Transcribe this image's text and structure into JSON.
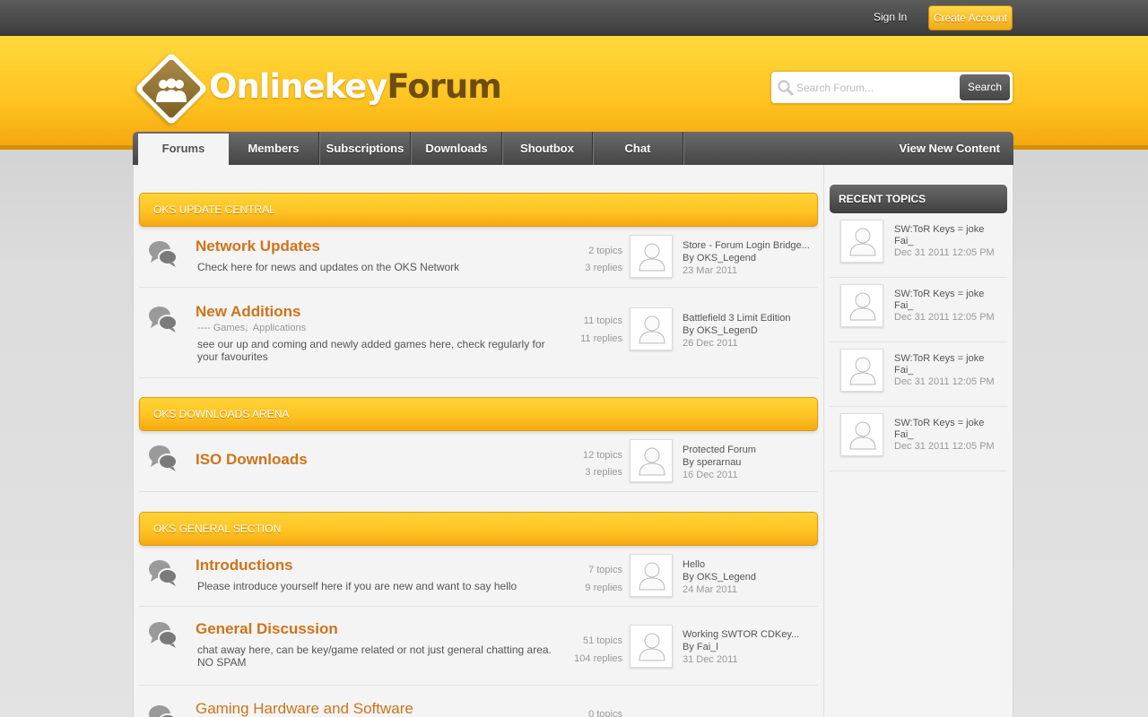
{
  "topbar": {
    "signin": "Sign In",
    "create_account": "Create Account"
  },
  "logo": {
    "part1": "Onlinekey",
    "part2": "Forum"
  },
  "search": {
    "placeholder": "Search Forum...",
    "button": "Search"
  },
  "nav": {
    "tabs": [
      "Forums",
      "Members",
      "Subscriptions",
      "Downloads",
      "Shoutbox",
      "Chat"
    ],
    "active": "Forums",
    "right": "View New Content"
  },
  "categories": [
    {
      "title": "OKS UPDATE CENTRAL"
    },
    {
      "title": "OKS DOWNLOADS ARENA"
    },
    {
      "title": "OKS GENERAL SECTION"
    }
  ],
  "forums": [
    {
      "title": "Network Updates",
      "desc": "Check here for news and updates on the OKS Network",
      "topics": "2 topics",
      "replies": "3 replies",
      "last_title": "Store - Forum Login Bridge...",
      "last_by": "By OKS_Legend",
      "last_date": "23 Mar 2011"
    },
    {
      "title": "New Additions",
      "sub_prefix": "----",
      "subforums": [
        "Games,",
        "Applications"
      ],
      "desc": "see our up and coming and newly added games here, check regularly for your favourites",
      "topics": "11 topics",
      "replies": "11 replies",
      "last_title": "Battlefield 3 Limit Edition",
      "last_by": "By OKS_LegenD",
      "last_date": "26 Dec 2011"
    },
    {
      "title": "ISO Downloads",
      "desc": "",
      "topics": "12 topics",
      "replies": "3 replies",
      "last_title": "Protected Forum",
      "last_by": "By sperarnau",
      "last_date": "16 Dec 2011"
    },
    {
      "title": "Introductions",
      "desc": "Please introduce yourself here if you are new and want to say hello",
      "topics": "7 topics",
      "replies": "9 replies",
      "last_title": "Hello",
      "last_by": "By OKS_Legend",
      "last_date": "24 Mar 2011"
    },
    {
      "title": "General Discussion",
      "desc": "chat away here, can be key/game related or not just general chatting area. NO SPAM",
      "topics": "51 topics",
      "replies": "104 replies",
      "last_title": "Working SWTOR CDKey...",
      "last_by": "By Fai_l",
      "last_date": "31 Dec 2011"
    },
    {
      "title": "Gaming Hardware and Software",
      "desc": "",
      "topics": "0 topics",
      "replies": "",
      "last_title": "",
      "last_by": "",
      "last_date": ""
    }
  ],
  "sidebar": {
    "title": "RECENT TOPICS",
    "items": [
      {
        "title": "SW:ToR Keys = joke",
        "by": "Fai_",
        "date": "Dec 31 2011 12:05 PM"
      },
      {
        "title": "SW:ToR Keys = joke",
        "by": "Fai_",
        "date": "Dec 31 2011 12:05 PM"
      },
      {
        "title": "SW:ToR Keys = joke",
        "by": "Fai_",
        "date": "Dec 31 2011 12:05 PM"
      },
      {
        "title": "SW:ToR Keys = joke",
        "by": "Fai_",
        "date": "Dec 31 2011 12:05 PM"
      }
    ]
  },
  "colors": {
    "accent": "#ffc323",
    "link": "#d0731a",
    "dark_bar": "#454545"
  },
  "icons": {
    "forum": "speech-bubbles-icon",
    "avatar": "user-silhouette-icon",
    "search": "magnifier-icon"
  }
}
